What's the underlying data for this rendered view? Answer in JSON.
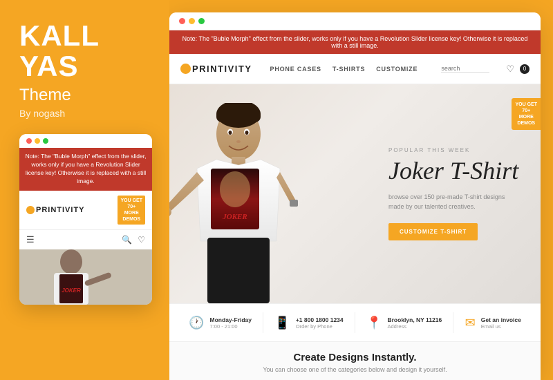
{
  "left": {
    "brand_line1": "KALL",
    "brand_line2": "YAS",
    "theme_label": "Theme",
    "by_label": "By nogash"
  },
  "mobile": {
    "banner_text": "Note: The \"Buble Morph\" effect from the slider, works only if you have a Revolution Slider license key! Otherwise it is replaced with a still image.",
    "logo_text": "PRINTIVITY",
    "demos_badge": "YOU GET\n70+\nMORE\nDEMOS"
  },
  "desktop": {
    "banner_text": "Note: The \"Buble Morph\" effect from the slider, works only if you have a Revolution Slider license key! Otherwise it is replaced with a still image.",
    "logo_text": "PRINTIVITY",
    "nav": {
      "link1": "PHONE CASES",
      "link2": "T-SHIRTS",
      "link3": "CUSTOMIZE"
    },
    "search_placeholder": "search",
    "hero": {
      "popular_label": "POPULAR THIS WEEK",
      "title": "Joker T-Shirt",
      "description": "browse over 150 pre-made T-shirt designs\nmade by our talented creatives.",
      "cta_btn": "CUSTOMIZE T-SHIRT"
    },
    "demos_badge": "YOU GET\n70+\nMORE\nDEMOS",
    "info": [
      {
        "icon": "🕐",
        "title": "Monday-Friday",
        "sub": "7:00 - 21:00"
      },
      {
        "icon": "📱",
        "title": "+1 800 1800 1234",
        "sub": "Order by Phone"
      },
      {
        "icon": "📍",
        "title": "Brooklyn, NY 11216",
        "sub": "Address"
      },
      {
        "icon": "✉",
        "title": "Get an invoice",
        "sub": "Email us"
      }
    ],
    "bottom": {
      "title": "Create Designs Instantly.",
      "subtitle": "You can choose one of the categories below and design it yourself."
    }
  }
}
